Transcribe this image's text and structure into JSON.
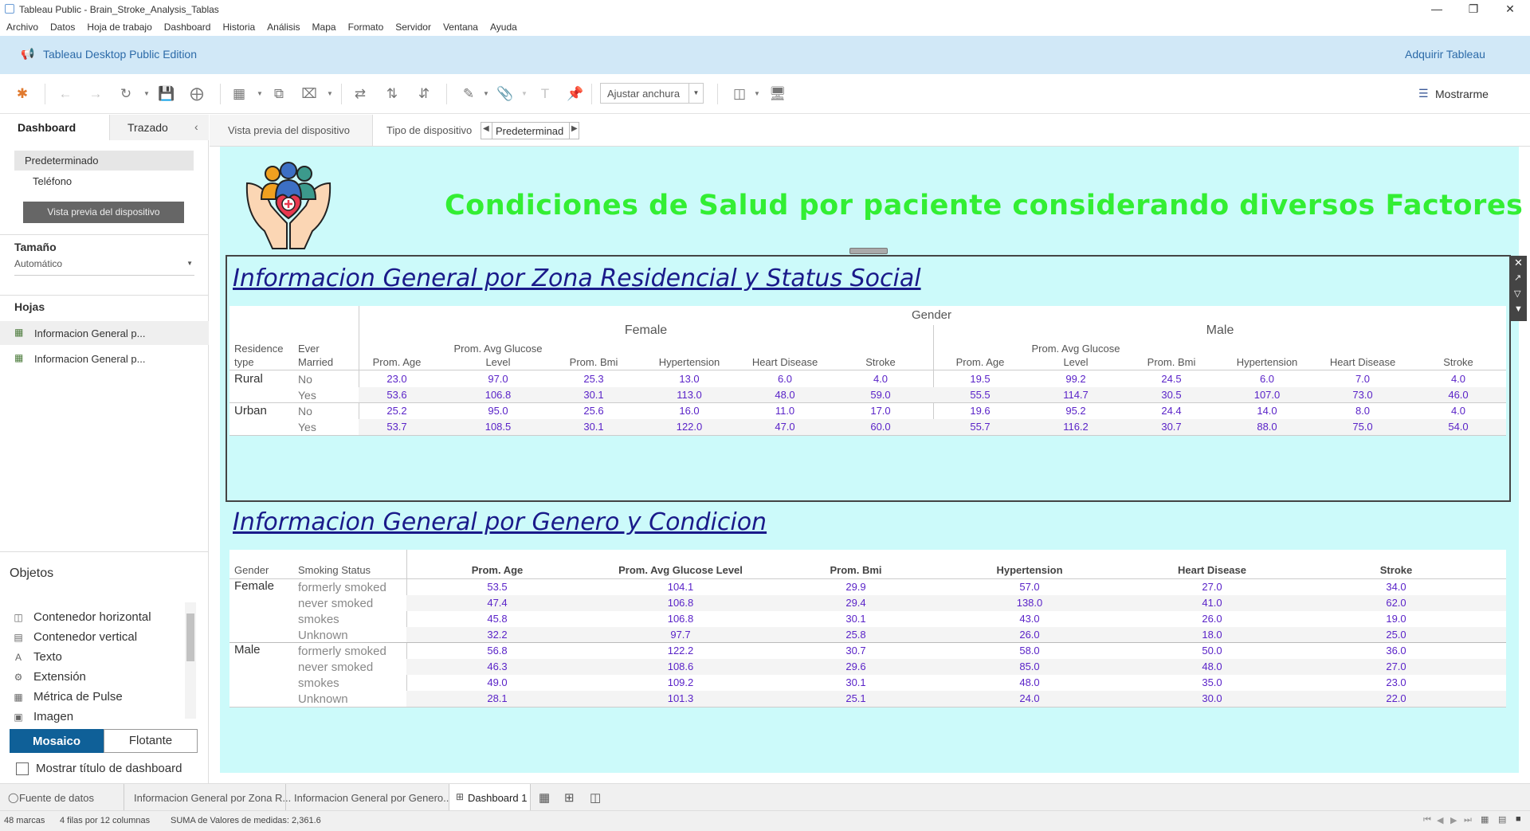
{
  "window": {
    "title": "Tableau Public - Brain_Stroke_Analysis_Tablas"
  },
  "menu": [
    "Archivo",
    "Datos",
    "Hoja de trabajo",
    "Dashboard",
    "Historia",
    "Análisis",
    "Mapa",
    "Formato",
    "Servidor",
    "Ventana",
    "Ayuda"
  ],
  "banner": {
    "edition": "Tableau Desktop Public Edition",
    "acquire": "Adquirir Tableau"
  },
  "toolbar": {
    "fit_label": "Ajustar anchura",
    "show_me": "Mostrarme"
  },
  "left_pane": {
    "tab_dashboard": "Dashboard",
    "tab_layout": "Trazado",
    "device_default": "Predeterminado",
    "device_phone": "Teléfono",
    "preview_button": "Vista previa del dispositivo",
    "size_header": "Tamaño",
    "size_value": "Automático",
    "sheets_header": "Hojas",
    "sheets": [
      "Informacion General p...",
      "Informacion General p..."
    ],
    "objects_header": "Objetos",
    "objects": [
      {
        "label": "Contenedor horizontal",
        "icon": "horizontal-container-icon"
      },
      {
        "label": "Contenedor vertical",
        "icon": "vertical-container-icon"
      },
      {
        "label": "Texto",
        "icon": "text-icon"
      },
      {
        "label": "Extensión",
        "icon": "extension-icon"
      },
      {
        "label": "Métrica de Pulse",
        "icon": "pulse-metric-icon"
      },
      {
        "label": "Imagen",
        "icon": "image-icon"
      }
    ],
    "tiled": "Mosaico",
    "floating": "Flotante",
    "show_title": "Mostrar título de dashboard"
  },
  "preview_bar": {
    "device_preview": "Vista previa del dispositivo",
    "device_type_label": "Tipo de dispositivo",
    "device_type_value": "Predeterminad"
  },
  "dashboard": {
    "main_title": "Condiciones de Salud por paciente considerando diversos Factores",
    "table1": {
      "title": "Informacion General por Zona Residencial y Status Social",
      "gender_header": "Gender",
      "female": "Female",
      "male": "Male",
      "row_hdr1": "Residence type",
      "row_hdr2": "Ever Married",
      "measures": [
        "Prom. Age",
        "Prom. Avg Glucose Level",
        "Prom. Bmi",
        "Hypertension",
        "Heart Disease",
        "Stroke"
      ],
      "rows": [
        {
          "res": "Rural",
          "married": "No",
          "female": [
            "23.0",
            "97.0",
            "25.3",
            "13.0",
            "6.0",
            "4.0"
          ],
          "male": [
            "19.5",
            "99.2",
            "24.5",
            "6.0",
            "7.0",
            "4.0"
          ]
        },
        {
          "res": "",
          "married": "Yes",
          "female": [
            "53.6",
            "106.8",
            "30.1",
            "113.0",
            "48.0",
            "59.0"
          ],
          "male": [
            "55.5",
            "114.7",
            "30.5",
            "107.0",
            "73.0",
            "46.0"
          ]
        },
        {
          "res": "Urban",
          "married": "No",
          "female": [
            "25.2",
            "95.0",
            "25.6",
            "16.0",
            "11.0",
            "17.0"
          ],
          "male": [
            "19.6",
            "95.2",
            "24.4",
            "14.0",
            "8.0",
            "4.0"
          ]
        },
        {
          "res": "",
          "married": "Yes",
          "female": [
            "53.7",
            "108.5",
            "30.1",
            "122.0",
            "47.0",
            "60.0"
          ],
          "male": [
            "55.7",
            "116.2",
            "30.7",
            "88.0",
            "75.0",
            "54.0"
          ]
        }
      ]
    },
    "table2": {
      "title": "Informacion General por Genero y Condicion",
      "hdr_gender": "Gender",
      "hdr_smoking": "Smoking Status",
      "measures": [
        "Prom. Age",
        "Prom. Avg Glucose Level",
        "Prom. Bmi",
        "Hypertension",
        "Heart Disease",
        "Stroke"
      ],
      "rows": [
        {
          "gender": "Female",
          "status": "formerly smoked",
          "v": [
            "53.5",
            "104.1",
            "29.9",
            "57.0",
            "27.0",
            "34.0"
          ]
        },
        {
          "gender": "",
          "status": "never smoked",
          "v": [
            "47.4",
            "106.8",
            "29.4",
            "138.0",
            "41.0",
            "62.0"
          ]
        },
        {
          "gender": "",
          "status": "smokes",
          "v": [
            "45.8",
            "106.8",
            "30.1",
            "43.0",
            "26.0",
            "19.0"
          ]
        },
        {
          "gender": "",
          "status": "Unknown",
          "v": [
            "32.2",
            "97.7",
            "25.8",
            "26.0",
            "18.0",
            "25.0"
          ]
        },
        {
          "gender": "Male",
          "status": "formerly smoked",
          "v": [
            "56.8",
            "122.2",
            "30.7",
            "58.0",
            "50.0",
            "36.0"
          ]
        },
        {
          "gender": "",
          "status": "never smoked",
          "v": [
            "46.3",
            "108.6",
            "29.6",
            "85.0",
            "48.0",
            "27.0"
          ]
        },
        {
          "gender": "",
          "status": "smokes",
          "v": [
            "49.0",
            "109.2",
            "30.1",
            "48.0",
            "35.0",
            "23.0"
          ]
        },
        {
          "gender": "",
          "status": "Unknown",
          "v": [
            "28.1",
            "101.3",
            "25.1",
            "24.0",
            "30.0",
            "22.0"
          ]
        }
      ]
    }
  },
  "bottom_tabs": {
    "datasource": "Fuente de datos",
    "sheet1": "Informacion General por Zona R...",
    "sheet2": "Informacion General por Genero...",
    "dashboard": "Dashboard 1"
  },
  "status": {
    "marks": "48 marcas",
    "rows_cols": "4 filas  por  12 columnas",
    "sum": "SUMA de Valores de medidas: 2,361.6"
  },
  "colors": {
    "canvas_bg": "#ccfafa",
    "title_green": "#33ee33",
    "sheet_title": "#1a1a8a",
    "value_purple": "#5a23c8",
    "banner": "#d1e8f7",
    "selected": "#0f6098"
  }
}
